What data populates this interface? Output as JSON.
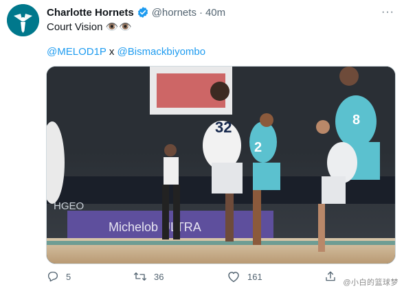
{
  "colors": {
    "accent": "#1d9bf0",
    "avatar_bg": "#00788c",
    "verified": "#1d9bf0",
    "muted": "#536471"
  },
  "tweet": {
    "author_name": "Charlotte Hornets",
    "handle": "@hornets",
    "separator": "·",
    "time": "40m",
    "text": "Court Vision",
    "emoji": "👁️👁️",
    "mention_1": "@MELOD1P",
    "mention_joiner": "x",
    "mention_2": "@Bismackbiyombo",
    "more_icon": "···"
  },
  "actions": {
    "reply_count": "5",
    "retweet_count": "36",
    "like_count": "161"
  },
  "watermark": "@小白的篮球梦",
  "icons": [
    "avatar-hornet-icon",
    "verified-badge-icon",
    "reply-icon",
    "retweet-icon",
    "like-icon",
    "share-icon"
  ]
}
